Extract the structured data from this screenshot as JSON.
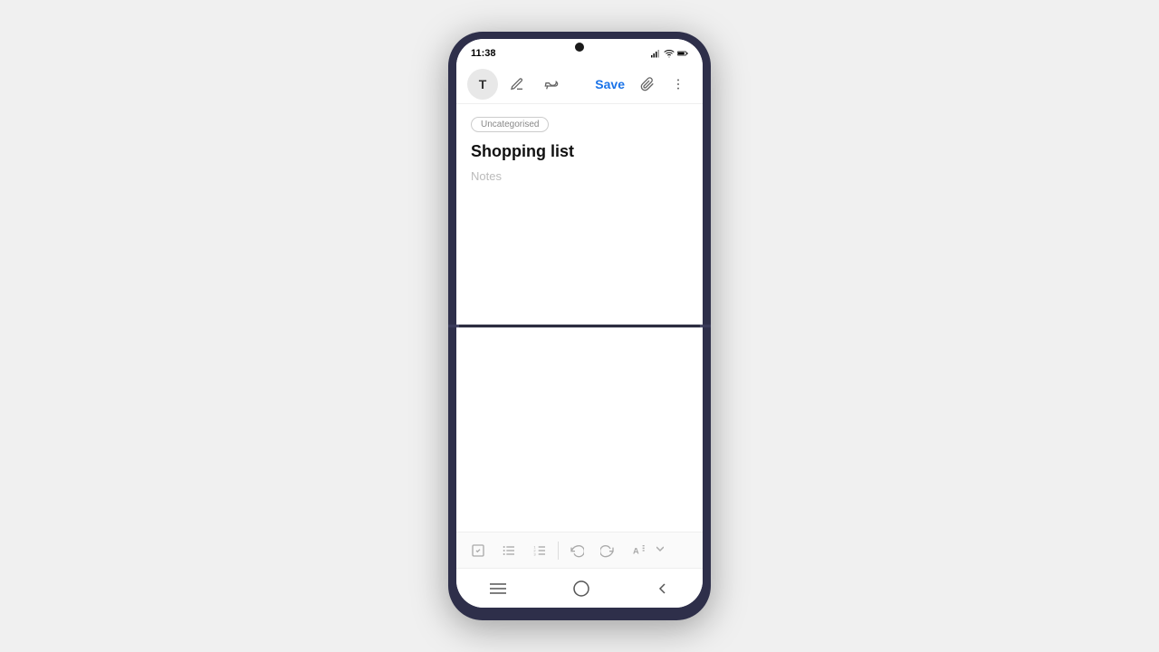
{
  "statusBar": {
    "time": "11:38"
  },
  "toolbar": {
    "textLabel": "T",
    "saveLabel": "Save",
    "icons": {
      "text": "T",
      "pen": "✏",
      "paint": "🖌",
      "attach": "📎",
      "more": "⋮"
    }
  },
  "note": {
    "category": "Uncategorised",
    "title": "Shopping list",
    "placeholder": "Notes"
  },
  "formatBar": {
    "checkbox": "☑",
    "unorderedList": "≡",
    "orderedList": "≣",
    "undo": "↩",
    "redo": "↪",
    "textFormat": "A"
  },
  "navBar": {
    "recent": "|||",
    "home": "○",
    "back": "<"
  }
}
